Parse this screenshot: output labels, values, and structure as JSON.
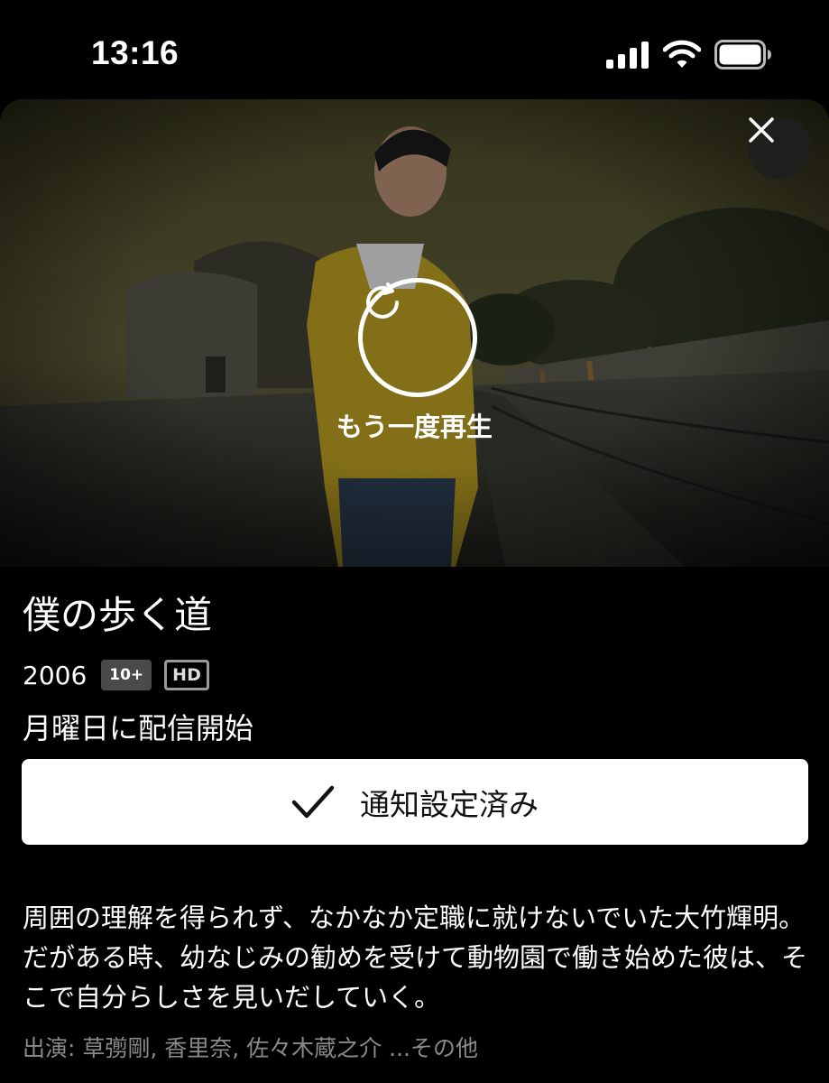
{
  "status_bar": {
    "time": "13:16",
    "icons": [
      "signal-icon",
      "wifi-icon",
      "battery-icon"
    ]
  },
  "hero": {
    "replay_label": "もう一度再生",
    "icons": [
      "close-icon",
      "replay-icon"
    ]
  },
  "show": {
    "title": "僕の歩く道",
    "year": "2006",
    "rating": "10+",
    "quality": "HD",
    "availability": "月曜日に配信開始"
  },
  "notify_button": {
    "label": "通知設定済み",
    "icon": "checkmark-icon"
  },
  "synopsis": "周囲の理解を得られず、なかなか定職に就けないでいた大竹輝明。だがある時、幼なじみの勧めを受けて動物園で働き始めた彼は、そこで自分らしさを見いだしていく。",
  "cast": {
    "prefix": "出演: ",
    "names": "草彅剛, 香里奈, 佐々木蔵之介",
    "more": " ...その他"
  },
  "colors": {
    "background": "#000000",
    "button_bg": "#ffffff",
    "rating_badge": "#4a4a4a",
    "muted_text": "#8a8a8a"
  }
}
